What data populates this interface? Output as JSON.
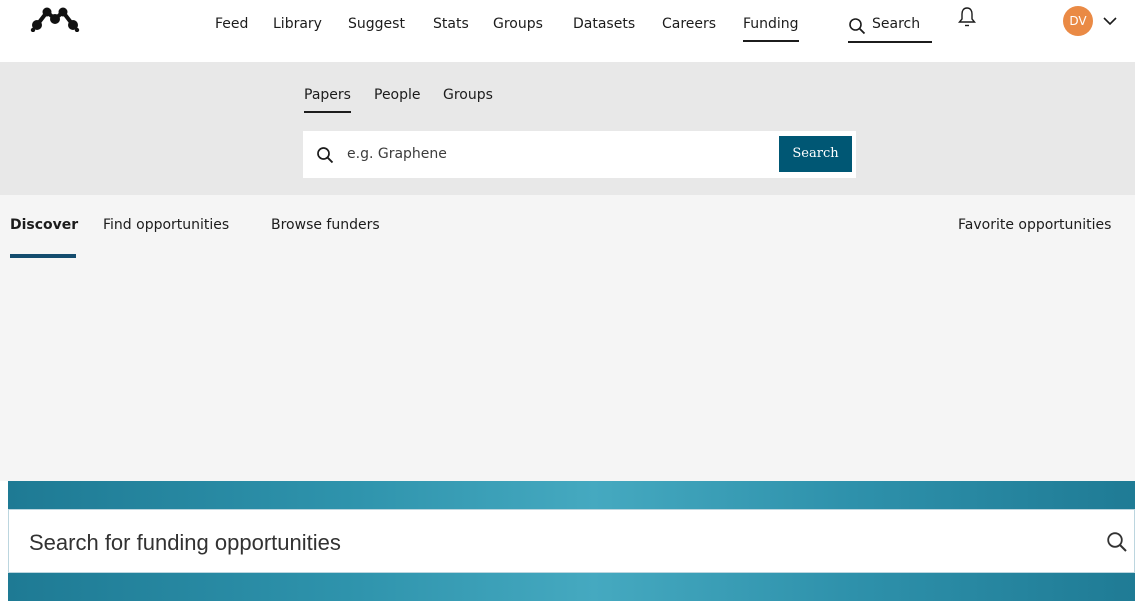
{
  "nav": {
    "logo": "mendeley-logo-icon",
    "items": [
      "Feed",
      "Library",
      "Suggest",
      "Stats",
      "Groups",
      "Datasets",
      "Careers",
      "Funding"
    ],
    "active": "Funding",
    "search_label": "Search",
    "search_icon": "search-icon",
    "notifications_icon": "bell-icon",
    "avatar_initials": "DV",
    "account_menu_icon": "chevron-down-icon"
  },
  "search_band": {
    "tabs": [
      "Papers",
      "People",
      "Groups"
    ],
    "active_tab": "Papers",
    "placeholder": "e.g. Graphene",
    "button": "Search"
  },
  "funding_nav": {
    "items": [
      "Discover",
      "Find opportunities",
      "Browse funders"
    ],
    "active": "Discover",
    "favorites": "Favorite opportunities"
  },
  "hero": {
    "placeholder": "Search for funding opportunities",
    "search_icon": "search-icon"
  },
  "colors": {
    "search_button": "#005774",
    "avatar": "#ea8a45",
    "active_tab_underline": "#144c6e",
    "hero_gradient": [
      "#1e7a94",
      "#45a9c0"
    ]
  }
}
